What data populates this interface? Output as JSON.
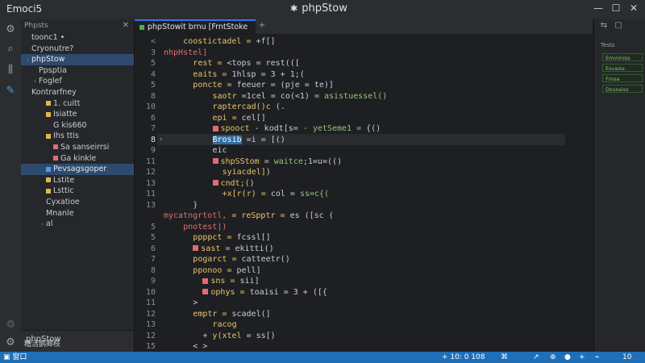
{
  "window": {
    "app_title": "Emoci5",
    "center_title": "phpStow",
    "logo_icon": "puzzle-icon"
  },
  "activity_bar": {
    "icons": [
      "gear-icon",
      "search-icon",
      "chart-icon",
      "debug-icon",
      "settings-bottom-icon",
      "account-icon"
    ]
  },
  "sidebar": {
    "header": "Phpsts",
    "close_icon": "close-icon",
    "tree": [
      {
        "label": "toonc1 •",
        "indent": 0,
        "twisty": "",
        "color": "#c9cdd2"
      },
      {
        "label": "Cryonutre?",
        "indent": 0,
        "twisty": "",
        "color": "#c9cdd2"
      },
      {
        "label": "phpStow",
        "indent": 0,
        "twisty": "›",
        "color": "#c9cdd2",
        "selected": true
      },
      {
        "label": "Ppsptia",
        "indent": 1,
        "twisty": "",
        "color": "#c9cdd2"
      },
      {
        "label": "Foglef",
        "indent": 1,
        "twisty": "›",
        "color": "#c9cdd2"
      },
      {
        "label": "Kontrarfney",
        "indent": 0,
        "twisty": "",
        "color": "#c9cdd2"
      },
      {
        "label": "1. cuitt",
        "indent": 2,
        "twisty": "",
        "color": "#c9cdd2",
        "icon": "#e0b84a"
      },
      {
        "label": "Isiatte",
        "indent": 2,
        "twisty": "",
        "color": "#c9cdd2",
        "icon": "#e0b84a"
      },
      {
        "label": "G kis660",
        "indent": 3,
        "twisty": "",
        "color": "#c9cdd2"
      },
      {
        "label": "Ihs ttis",
        "indent": 2,
        "twisty": "",
        "color": "#c9cdd2",
        "icon": "#e0b84a"
      },
      {
        "label": "Sa sanseirrsi",
        "indent": 3,
        "twisty": "",
        "color": "#c9cdd2",
        "icon": "#e06c75"
      },
      {
        "label": "Ga kinkle",
        "indent": 3,
        "twisty": "",
        "color": "#c9cdd2",
        "icon": "#e06c75"
      },
      {
        "label": "Pevsagsgoper",
        "indent": 2,
        "twisty": "",
        "color": "#c9cdd2",
        "icon": "#4f9be8",
        "selected": true
      },
      {
        "label": "Lstite",
        "indent": 2,
        "twisty": "",
        "color": "#c9cdd2",
        "icon": "#e0b84a"
      },
      {
        "label": "Lsttic",
        "indent": 2,
        "twisty": "",
        "color": "#c9cdd2",
        "icon": "#e0b84a"
      },
      {
        "label": "Cyxatioe",
        "indent": 2,
        "twisty": "",
        "color": "#c9cdd2"
      },
      {
        "label": "Mnanle",
        "indent": 2,
        "twisty": "",
        "color": "#c9cdd2"
      },
      {
        "label": "al",
        "indent": 2,
        "twisty": "›",
        "color": "#c9cdd2"
      }
    ],
    "bottom_label": "phpStow",
    "footer_label": "糟活鹅卿枝"
  },
  "editor": {
    "tab_label": "phpStowit brnu  [FrntStoke",
    "tab_close": "+",
    "lines": [
      {
        "n": "<",
        "indent": 2,
        "parts": [
          {
            "t": "coostictadel = ",
            "c": "fn"
          },
          {
            "t": "+f[]",
            "c": "pl"
          }
        ]
      },
      {
        "n": "3",
        "indent": 0,
        "parts": [
          {
            "t": "nhpHstel]",
            "c": "pk"
          }
        ]
      },
      {
        "n": "5",
        "indent": 3,
        "parts": [
          {
            "t": "rest = ",
            "c": "fn"
          },
          {
            "t": "<tops = rest(([",
            "c": "pl"
          }
        ]
      },
      {
        "n": "4",
        "indent": 3,
        "parts": [
          {
            "t": "eaits = ",
            "c": "fn"
          },
          {
            "t": "1hlsp = 3 + 1;(",
            "c": "pl"
          }
        ]
      },
      {
        "n": "5",
        "indent": 3,
        "parts": [
          {
            "t": "poncte = ",
            "c": "fn"
          },
          {
            "t": "feeuer = (pje = te)]",
            "c": "pl"
          }
        ]
      },
      {
        "n": "8",
        "indent": 5,
        "parts": [
          {
            "t": "saotr",
            "c": "fn"
          },
          {
            "t": " =1cel = co(<1) = ",
            "c": "pl"
          },
          {
            "t": "asistuessel()",
            "c": "str"
          }
        ]
      },
      {
        "n": "10",
        "indent": 5,
        "parts": [
          {
            "t": "raptercad()c ",
            "c": "fn"
          },
          {
            "t": "(.",
            "c": "pl"
          }
        ]
      },
      {
        "n": "6",
        "indent": 5,
        "parts": [
          {
            "t": "epi = ",
            "c": "fn"
          },
          {
            "t": "cel[]",
            "c": "pl"
          }
        ]
      },
      {
        "n": "7",
        "indent": 5,
        "mark": true,
        "parts": [
          {
            "t": "spooct",
            "c": "fn"
          },
          {
            "t": " - kodt[s= ",
            "c": "pl"
          },
          {
            "t": "- yetSeme1 = ",
            "c": "str"
          },
          {
            "t": "{()",
            "c": "pl"
          }
        ]
      },
      {
        "n": "8",
        "indent": 5,
        "current": true,
        "parts": [
          {
            "t": "Brosib",
            "c": "sel"
          },
          {
            "t": " =i = [()",
            "c": "pl"
          }
        ]
      },
      {
        "n": "9",
        "indent": 5,
        "parts": [
          {
            "t": "eic",
            "c": "pl"
          }
        ]
      },
      {
        "n": "11",
        "indent": 5,
        "mark": true,
        "parts": [
          {
            "t": "shpSStom",
            "c": "fn"
          },
          {
            "t": " = ",
            "c": "pl"
          },
          {
            "t": "waitce",
            "c": "str"
          },
          {
            "t": ";1=u=(()",
            "c": "pl"
          }
        ]
      },
      {
        "n": "12",
        "indent": 6,
        "parts": [
          {
            "t": "syiacdel]",
            "c": "fn"
          },
          {
            "t": ")",
            "c": "pl"
          }
        ]
      },
      {
        "n": "13",
        "indent": 5,
        "mark": true,
        "parts": [
          {
            "t": "cndt;(",
            "c": "fn"
          },
          {
            "t": ")",
            "c": "pl"
          }
        ]
      },
      {
        "n": "11",
        "indent": 6,
        "parts": [
          {
            "t": "+x[r(r) = ",
            "c": "fn"
          },
          {
            "t": "col = ",
            "c": "pl"
          },
          {
            "t": "ss=c{(",
            "c": "str"
          }
        ]
      },
      {
        "n": "13",
        "indent": 3,
        "parts": [
          {
            "t": "}",
            "c": "pl"
          }
        ]
      },
      {
        "n": "",
        "indent": 0,
        "parts": [
          {
            "t": "mycatngrtotl,",
            "c": "pk"
          },
          {
            "t": " = reSpptr = ",
            "c": "fn"
          },
          {
            "t": "es ([sc (",
            "c": "pl"
          }
        ]
      },
      {
        "n": "5",
        "indent": 2,
        "parts": [
          {
            "t": "pnotest|)",
            "c": "pk"
          }
        ]
      },
      {
        "n": "5",
        "indent": 3,
        "parts": [
          {
            "t": "ppppct = ",
            "c": "fn"
          },
          {
            "t": "fcssl[]",
            "c": "pl"
          }
        ]
      },
      {
        "n": "6",
        "indent": 3,
        "mark": true,
        "parts": [
          {
            "t": "sast = ",
            "c": "fn"
          },
          {
            "t": "ekitti()",
            "c": "pl"
          }
        ]
      },
      {
        "n": "7",
        "indent": 3,
        "parts": [
          {
            "t": "pogarct = ",
            "c": "fn"
          },
          {
            "t": "catteetr()",
            "c": "pl"
          }
        ]
      },
      {
        "n": "8",
        "indent": 3,
        "parts": [
          {
            "t": "pponoo = ",
            "c": "fn"
          },
          {
            "t": "pell]",
            "c": "pl"
          }
        ]
      },
      {
        "n": "9",
        "indent": 4,
        "mark": true,
        "parts": [
          {
            "t": "sns = ",
            "c": "fn"
          },
          {
            "t": "sii]",
            "c": "pl"
          }
        ]
      },
      {
        "n": "10",
        "indent": 4,
        "mark": true,
        "parts": [
          {
            "t": "ophys = ",
            "c": "fn"
          },
          {
            "t": "toaisi = 3 + ([{",
            "c": "pl"
          }
        ]
      },
      {
        "n": "11",
        "indent": 3,
        "parts": [
          {
            "t": ">",
            "c": "pl"
          }
        ]
      },
      {
        "n": "12",
        "indent": 3,
        "parts": [
          {
            "t": "emptr = ",
            "c": "fn"
          },
          {
            "t": "scadel(]",
            "c": "pl"
          }
        ]
      },
      {
        "n": "13",
        "indent": 5,
        "parts": [
          {
            "t": "racog",
            "c": "fn"
          }
        ]
      },
      {
        "n": "12",
        "indent": 4,
        "parts": [
          {
            "t": "+ y(xtel",
            "c": "fn"
          },
          {
            "t": " = ss[)",
            "c": "pl"
          }
        ]
      },
      {
        "n": "15",
        "indent": 3,
        "parts": [
          {
            "t": "< >",
            "c": "pl"
          }
        ]
      }
    ]
  },
  "right_panel": {
    "icons": [
      "chevron-icon",
      "panel-icon"
    ],
    "section_label": "Tests",
    "cards": [
      "Emviiniss",
      "Esvaiss",
      "Fmsa",
      "Dsusaiss"
    ]
  },
  "statusbar": {
    "left_label": "窗口",
    "items": [
      "+ 10: 0 108",
      "⌘",
      "↗",
      "⊕",
      "●",
      "+",
      "⌁",
      "10"
    ]
  }
}
